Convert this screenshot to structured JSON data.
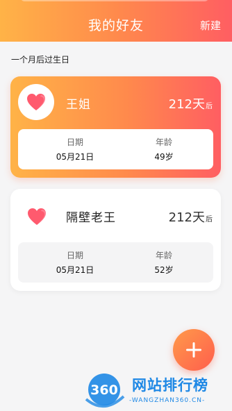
{
  "header": {
    "title": "我的好友",
    "action_label": "新建"
  },
  "section": {
    "title": "一个月后过生日"
  },
  "friends": [
    {
      "name": "王姐",
      "days": "212天",
      "days_unit": "后",
      "date_label": "日期",
      "date_value": "05月21日",
      "age_label": "年龄",
      "age_value": "49岁",
      "avatar_icon": "heart-icon"
    },
    {
      "name": "隔壁老王",
      "days": "212天",
      "days_unit": "后",
      "date_label": "日期",
      "date_value": "05月21日",
      "age_label": "年龄",
      "age_value": "52岁",
      "avatar_icon": "heart-icon"
    }
  ],
  "fab": {
    "icon": "plus-icon"
  },
  "watermark": {
    "logo_text": "360",
    "title": "网站排行榜",
    "url": "-WANGZHAN360.CN-"
  },
  "colors": {
    "accent_start": "#ffb347",
    "accent_end": "#ff5e62",
    "heart": "#ff5a6e",
    "watermark_blue": "#1e88e5"
  }
}
